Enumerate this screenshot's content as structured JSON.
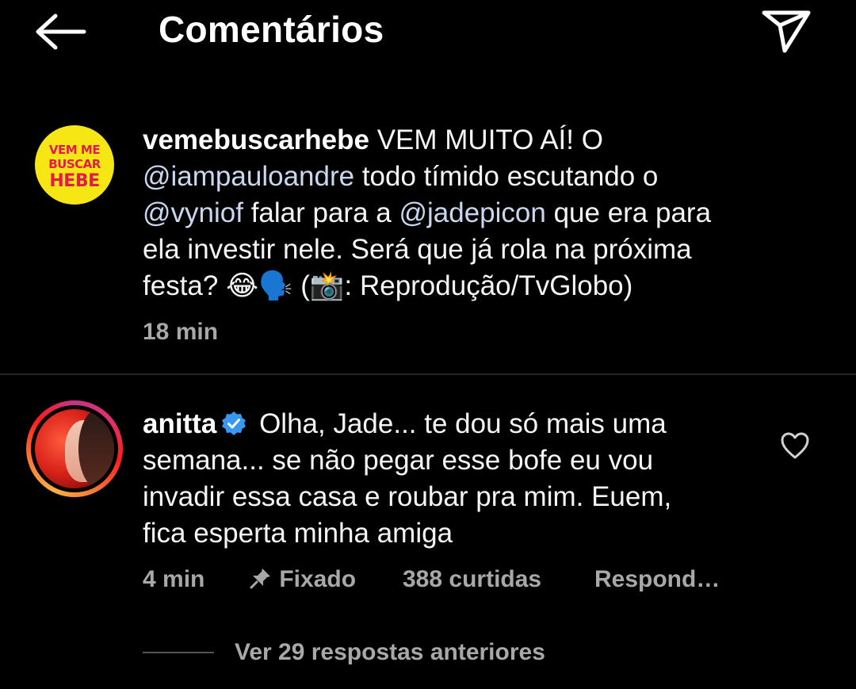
{
  "header": {
    "title": "Comentários"
  },
  "post": {
    "avatar_text": [
      "VEM ME",
      "BUSCAR",
      "HEBE"
    ],
    "username": "vemebuscarhebe",
    "text_1": " VEM MUITO AÍ! O",
    "mention_1": "@iampauloandre",
    "text_2": " todo tímido escutando o",
    "mention_2": "@vyniof",
    "text_3": " falar para a ",
    "mention_3": "@jadepicon",
    "text_4": " que era para",
    "text_5": "ela investir nele. Será que já rola na próxima",
    "text_6": "festa? 😂🗣️ (📸: Reprodução/TvGlobo)",
    "time": "18 min"
  },
  "reply": {
    "username": "anitta",
    "line_1": " Olha, Jade... te dou só mais uma",
    "line_2": "semana... se não pegar esse bofe eu vou",
    "line_3": "invadir essa casa e roubar pra mim. Euem,",
    "line_4": "fica esperta minha amiga",
    "time": "4 min",
    "pinned": "Fixado",
    "likes": "388 curtidas",
    "reply_label": "Respond…",
    "view_replies": "Ver 29 respostas anteriores"
  },
  "colors": {
    "background": "#000000",
    "text": "#f5f5f5",
    "muted": "#a8a8a8",
    "mention": "#c9d8f0",
    "verified": "#3897f0",
    "hebe_yellow": "#f6e714",
    "hebe_red": "#e21b4d"
  },
  "icons": [
    "arrow-left-icon",
    "send-icon",
    "verified-icon",
    "heart-icon",
    "pin-icon"
  ]
}
